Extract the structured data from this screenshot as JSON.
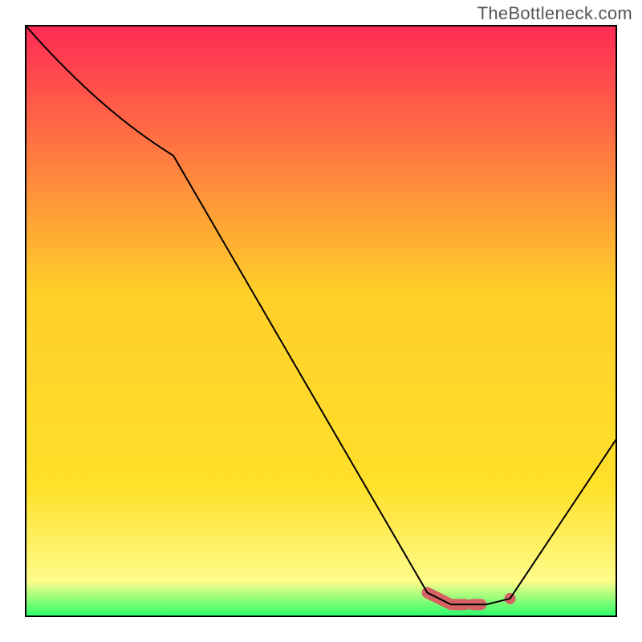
{
  "watermark": "TheBottleneck.com",
  "colors": {
    "gradient_top": "#ff2a55",
    "gradient_mid1": "#ff8a2a",
    "gradient_mid2": "#ffe02a",
    "gradient_low": "#fffc8a",
    "gradient_bottom": "#2aff6a",
    "curve": "#000000",
    "highlight": "#d66363",
    "frame": "#000000"
  },
  "chart_data": {
    "type": "line",
    "title": "",
    "xlabel": "",
    "ylabel": "",
    "xlim": [
      0,
      100
    ],
    "ylim": [
      0,
      100
    ],
    "series": [
      {
        "name": "bottleneck-curve",
        "x": [
          0,
          25,
          68,
          72,
          78,
          82,
          100
        ],
        "values": [
          100,
          78,
          4,
          2,
          2,
          3,
          30
        ]
      }
    ],
    "highlight": {
      "name": "optimal-zone",
      "segments": [
        {
          "x": [
            68,
            72
          ],
          "values": [
            4,
            2
          ]
        },
        {
          "x": [
            72,
            78
          ],
          "values": [
            2,
            2
          ]
        }
      ],
      "point": {
        "x": 82,
        "value": 3
      }
    },
    "background_gradient_stops": [
      {
        "offset": 0.0,
        "value": 100
      },
      {
        "offset": 0.45,
        "value": 55
      },
      {
        "offset": 0.78,
        "value": 22
      },
      {
        "offset": 0.94,
        "value": 6
      },
      {
        "offset": 1.0,
        "value": 0
      }
    ]
  }
}
